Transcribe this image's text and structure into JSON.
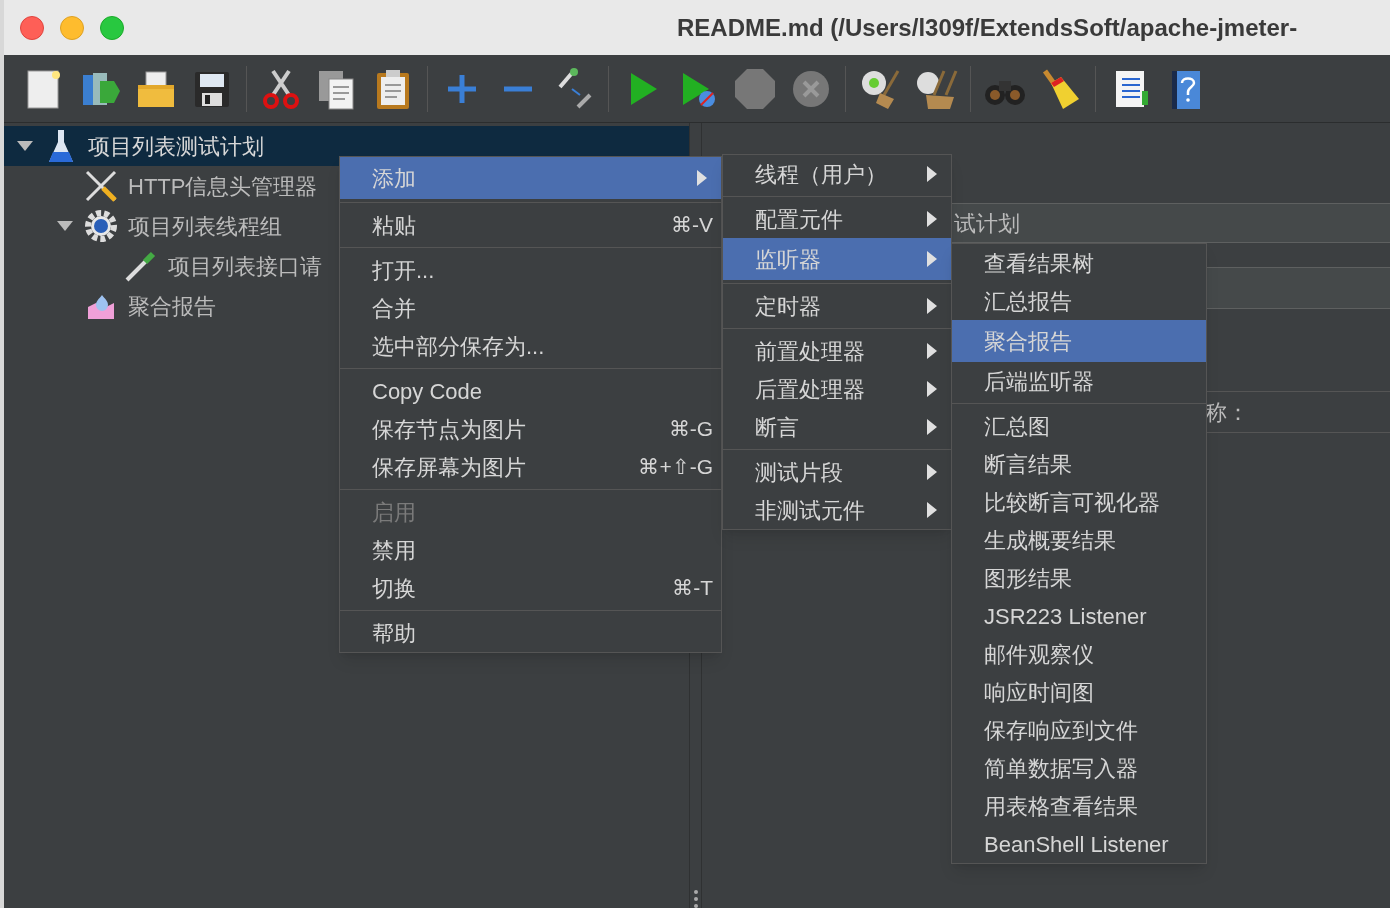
{
  "window": {
    "title": "README.md (/Users/l309f/ExtendsSoft/apache-jmeter-"
  },
  "tree": [
    {
      "label": "项目列表测试计划",
      "kind": "plan",
      "selected": true,
      "expanded": true,
      "children": [
        {
          "label": "HTTP信息头管理器",
          "kind": "config",
          "selected": false
        },
        {
          "label": "项目列表线程组",
          "kind": "threadgroup",
          "selected": false,
          "expanded": true,
          "children": [
            {
              "label": "项目列表接口请",
              "kind": "sampler",
              "selected": false
            }
          ]
        },
        {
          "label": "聚合报告",
          "kind": "listener",
          "selected": false
        }
      ]
    }
  ],
  "details": {
    "field_value": "试计划",
    "field_label": "称："
  },
  "context_menu": {
    "groups": [
      [
        {
          "label": "添加",
          "selected": true,
          "disabled": false,
          "submenu": true
        }
      ],
      [
        {
          "label": "粘贴",
          "shortcut": "⌘-V",
          "selected": false,
          "disabled": false,
          "submenu": false
        }
      ],
      [
        {
          "label": "打开...",
          "selected": false,
          "disabled": false,
          "submenu": false
        },
        {
          "label": "合并",
          "selected": false,
          "disabled": false,
          "submenu": false
        },
        {
          "label": "选中部分保存为...",
          "selected": false,
          "disabled": false,
          "submenu": false
        }
      ],
      [
        {
          "label": "Copy Code",
          "selected": false,
          "disabled": false,
          "submenu": false
        },
        {
          "label": "保存节点为图片",
          "shortcut": "⌘-G",
          "selected": false,
          "disabled": false,
          "submenu": false
        },
        {
          "label": "保存屏幕为图片",
          "shortcut": "⌘+⇧-G",
          "selected": false,
          "disabled": false,
          "submenu": false
        }
      ],
      [
        {
          "label": "启用",
          "selected": false,
          "disabled": true,
          "submenu": false
        },
        {
          "label": "禁用",
          "selected": false,
          "disabled": false,
          "submenu": false
        },
        {
          "label": "切换",
          "shortcut": "⌘-T",
          "selected": false,
          "disabled": false,
          "submenu": false
        }
      ],
      [
        {
          "label": "帮助",
          "selected": false,
          "disabled": false,
          "submenu": false
        }
      ]
    ]
  },
  "add_submenu": {
    "groups": [
      [
        {
          "label": "线程（用户）",
          "selected": false,
          "submenu": true
        }
      ],
      [
        {
          "label": "配置元件",
          "selected": false,
          "submenu": true
        },
        {
          "label": "监听器",
          "selected": true,
          "submenu": true
        }
      ],
      [
        {
          "label": "定时器",
          "selected": false,
          "submenu": true
        }
      ],
      [
        {
          "label": "前置处理器",
          "selected": false,
          "submenu": true
        },
        {
          "label": "后置处理器",
          "selected": false,
          "submenu": true
        },
        {
          "label": "断言",
          "selected": false,
          "submenu": true
        }
      ],
      [
        {
          "label": "测试片段",
          "selected": false,
          "submenu": true
        },
        {
          "label": "非测试元件",
          "selected": false,
          "submenu": true
        }
      ]
    ]
  },
  "listener_submenu": {
    "groups": [
      [
        {
          "label": "查看结果树",
          "selected": false
        },
        {
          "label": "汇总报告",
          "selected": false
        },
        {
          "label": "聚合报告",
          "selected": true
        },
        {
          "label": "后端监听器",
          "selected": false
        }
      ],
      [
        {
          "label": "汇总图",
          "selected": false
        },
        {
          "label": "断言结果",
          "selected": false
        },
        {
          "label": "比较断言可视化器",
          "selected": false
        },
        {
          "label": "生成概要结果",
          "selected": false
        },
        {
          "label": "图形结果",
          "selected": false
        },
        {
          "label": "JSR223 Listener",
          "selected": false
        },
        {
          "label": "邮件观察仪",
          "selected": false
        },
        {
          "label": "响应时间图",
          "selected": false
        },
        {
          "label": "保存响应到文件",
          "selected": false
        },
        {
          "label": "简单数据写入器",
          "selected": false
        },
        {
          "label": "用表格查看结果",
          "selected": false
        },
        {
          "label": "BeanShell Listener",
          "selected": false
        }
      ]
    ]
  }
}
